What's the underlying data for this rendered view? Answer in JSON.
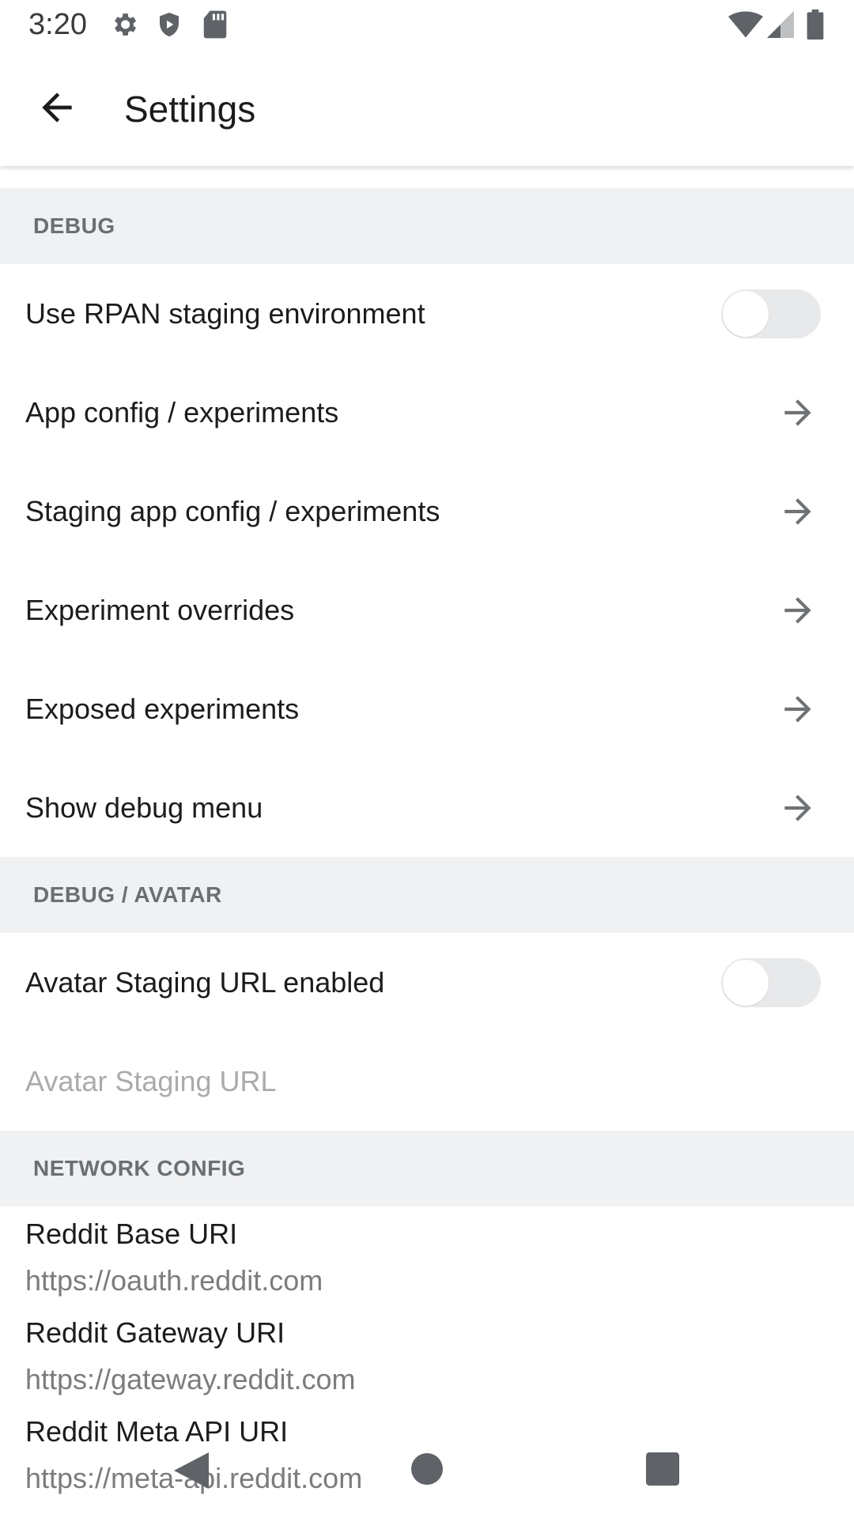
{
  "status_bar": {
    "time": "3:20",
    "left_icons": [
      "gear-icon",
      "shield-icon",
      "sd-card-icon"
    ],
    "right_icons": [
      "wifi-icon",
      "cell-signal-icon",
      "battery-icon"
    ]
  },
  "app_bar": {
    "title": "Settings",
    "back_icon": "arrow-left-icon"
  },
  "sections": {
    "debug": {
      "header": "DEBUG",
      "items": [
        {
          "label": "Use RPAN staging environment",
          "control": "toggle",
          "on": false
        },
        {
          "label": "App config / experiments",
          "control": "arrow"
        },
        {
          "label": "Staging app config / experiments",
          "control": "arrow"
        },
        {
          "label": "Experiment overrides",
          "control": "arrow"
        },
        {
          "label": "Exposed experiments",
          "control": "arrow"
        },
        {
          "label": "Show debug menu",
          "control": "arrow"
        }
      ]
    },
    "avatar": {
      "header": "DEBUG / AVATAR",
      "items": [
        {
          "label": "Avatar Staging URL enabled",
          "control": "toggle",
          "on": false
        },
        {
          "label": "Avatar Staging URL",
          "control": "disabled"
        }
      ]
    },
    "network": {
      "header": "NETWORK CONFIG",
      "items": [
        {
          "title": "Reddit Base URI",
          "value": "https://oauth.reddit.com"
        },
        {
          "title": "Reddit Gateway URI",
          "value": "https://gateway.reddit.com"
        },
        {
          "title": "Reddit Meta API URI",
          "value": "https://meta-api.reddit.com"
        }
      ]
    }
  },
  "nav_bar": {
    "buttons": [
      "back-triangle-icon",
      "home-circle-icon",
      "recents-square-icon"
    ]
  },
  "colors": {
    "section_bg": "#f0f1f3",
    "section_text": "#6b6f73",
    "primary_text": "#1c1c1c",
    "secondary_text": "#7a7c7e",
    "disabled_text": "#a9abad",
    "toggle_track": "#e8e9eb",
    "arrow": "#6f7275"
  }
}
